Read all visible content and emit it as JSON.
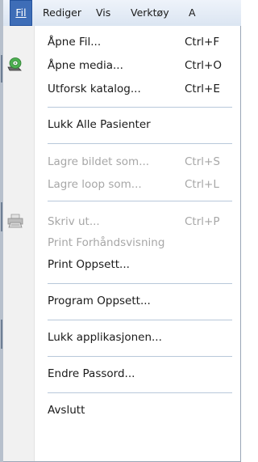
{
  "menubar": {
    "items": [
      "Fil",
      "Rediger",
      "Vis",
      "Verktøy",
      "A"
    ]
  },
  "menu": {
    "items": [
      {
        "label": "Åpne Fil...",
        "shortcut": "Ctrl+F"
      },
      {
        "label": "Åpne media...",
        "shortcut": "Ctrl+O",
        "icon": "media-disc-icon"
      },
      {
        "label": "Utforsk katalog...",
        "shortcut": "Ctrl+E"
      },
      {
        "label": "Lukk Alle Pasienter",
        "shortcut": ""
      },
      {
        "label": "Lagre bildet som...",
        "shortcut": "Ctrl+S",
        "disabled": true
      },
      {
        "label": "Lagre loop som...",
        "shortcut": "Ctrl+L",
        "disabled": true
      },
      {
        "label": "Skriv ut...",
        "shortcut": "Ctrl+P",
        "disabled": true,
        "icon": "printer-icon"
      },
      {
        "label": "Print Forhåndsvisning",
        "shortcut": "",
        "disabled": true
      },
      {
        "label": "Print Oppsett...",
        "shortcut": ""
      },
      {
        "label": "Program Oppsett...",
        "shortcut": ""
      },
      {
        "label": "Lukk applikasjonen...",
        "shortcut": ""
      },
      {
        "label": "Endre Passord...",
        "shortcut": ""
      },
      {
        "label": "Avslutt",
        "shortcut": ""
      }
    ]
  },
  "colors": {
    "accent": "#3e6db7",
    "disabled_text": "#a7a7a7",
    "separator": "#b8c8da"
  }
}
